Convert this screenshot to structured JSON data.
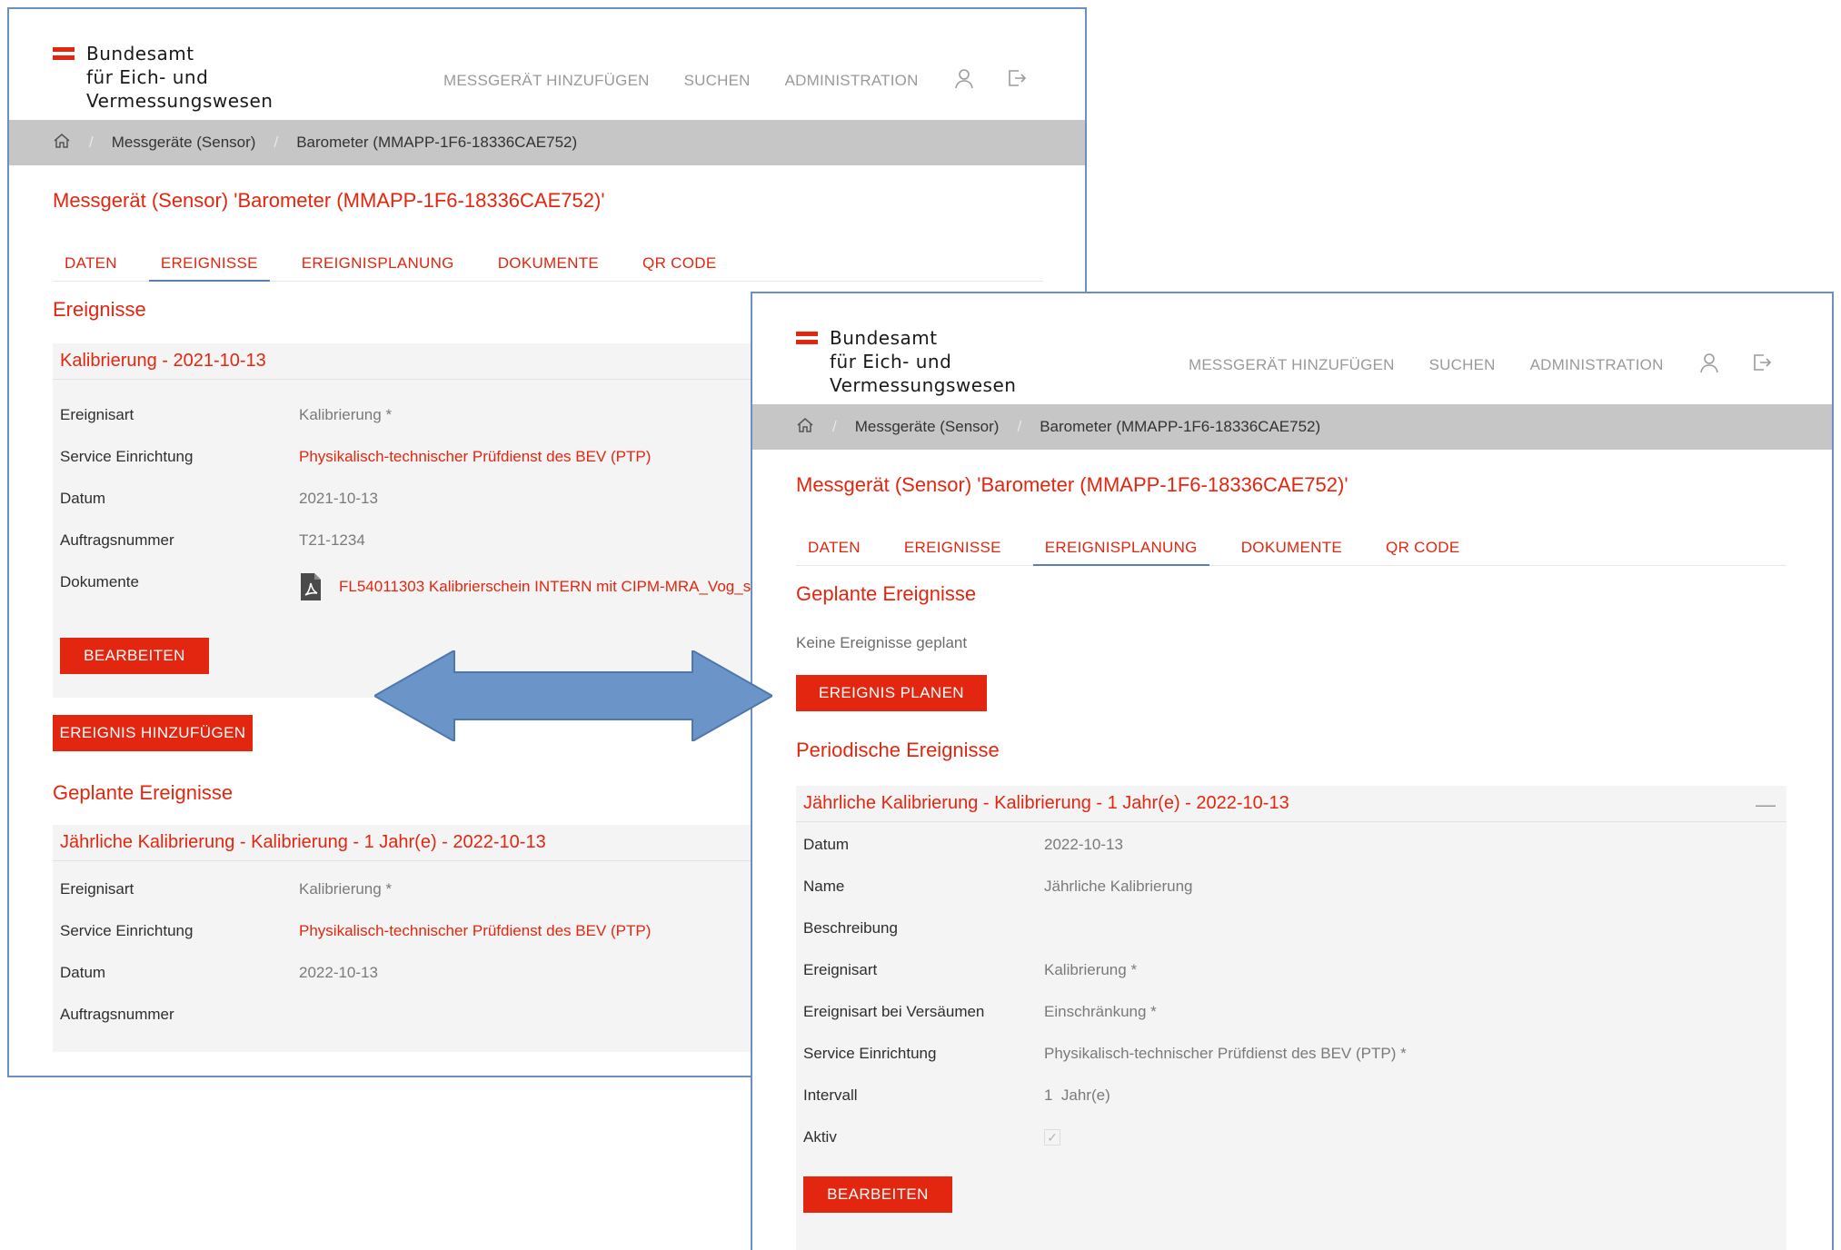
{
  "brand": {
    "line1": "Bundesamt",
    "line2": "für Eich- und",
    "line3": "Vermessungswesen",
    "accent_color": "#e3260f"
  },
  "nav": {
    "add_device": "MESSGERÄT HINZUFÜGEN",
    "search": "SUCHEN",
    "admin": "ADMINISTRATION",
    "user_icon": "user-icon",
    "logout_icon": "logout-icon"
  },
  "breadcrumb": {
    "home_icon": "home-icon",
    "sep": "/",
    "level1": "Messgeräte (Sensor)",
    "level2": "Barometer (MMAPP-1F6-18336CAE752)"
  },
  "page_title": "Messgerät (Sensor) 'Barometer (MMAPP-1F6-18336CAE752)'",
  "tabs": [
    "DATEN",
    "EREIGNISSE",
    "EREIGNISPLANUNG",
    "DOKUMENTE",
    "QR CODE"
  ],
  "window_left": {
    "active_tab": "EREIGNISSE",
    "events_heading": "Ereignisse",
    "event": {
      "title": "Kalibrierung - 2021-10-13",
      "rows": [
        {
          "label": "Ereignisart",
          "value": "Kalibrierung *"
        },
        {
          "label": "Service Einrichtung",
          "value": "Physikalisch-technischer Prüfdienst des BEV (PTP)"
        },
        {
          "label": "Datum",
          "value": "2021-10-13"
        },
        {
          "label": "Auftragsnummer",
          "value": "T21-1234"
        },
        {
          "label": "Dokumente",
          "value": "FL54011303 Kalibrierschein INTERN mit CIPM-MRA_Vog_s"
        }
      ],
      "doc_icon": "pdf-icon",
      "edit_button": "BEARBEITEN"
    },
    "add_event_button": "EREIGNIS HINZUFÜGEN",
    "planned_heading": "Geplante Ereignisse",
    "planned_event": {
      "title": "Jährliche Kalibrierung - Kalibrierung - 1 Jahr(e) - 2022-10-13",
      "rows": [
        {
          "label": "Ereignisart",
          "value": "Kalibrierung *"
        },
        {
          "label": "Service Einrichtung",
          "value": "Physikalisch-technischer Prüfdienst des BEV (PTP)"
        },
        {
          "label": "Datum",
          "value": "2022-10-13"
        },
        {
          "label": "Auftragsnummer",
          "value": ""
        }
      ]
    }
  },
  "window_right": {
    "active_tab": "EREIGNISPLANUNG",
    "planned_heading": "Geplante Ereignisse",
    "no_events_text": "Keine Ereignisse geplant",
    "plan_button": "EREIGNIS PLANEN",
    "periodic_heading": "Periodische Ereignisse",
    "periodic_event": {
      "title": "Jährliche Kalibrierung - Kalibrierung - 1 Jahr(e) - 2022-10-13",
      "collapse_symbol": "—",
      "rows": [
        {
          "label": "Datum",
          "value": "2022-10-13"
        },
        {
          "label": "Name",
          "value": "Jährliche Kalibrierung"
        },
        {
          "label": "Beschreibung",
          "value": ""
        },
        {
          "label": "Ereignisart",
          "value": "Kalibrierung *"
        },
        {
          "label": "Ereignisart bei Versäumen",
          "value": "Einschränkung *"
        },
        {
          "label": "Service Einrichtung",
          "value": "Physikalisch-technischer Prüfdienst des BEV (PTP) *"
        },
        {
          "label": "Intervall",
          "value": "1  Jahr(e)"
        },
        {
          "label": "Aktiv",
          "value": "✓"
        }
      ],
      "edit_button": "BEARBEITEN"
    }
  },
  "arrow": {
    "color": "#6b94c8",
    "icon": "double-arrow-icon"
  }
}
